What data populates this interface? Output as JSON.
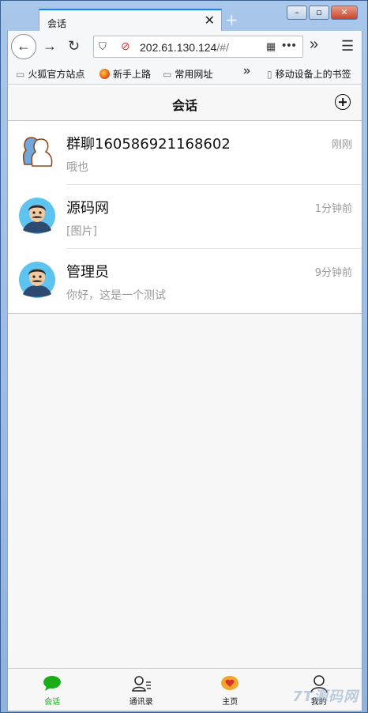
{
  "browser": {
    "tab_title": "会话",
    "tab_close": "✕",
    "new_tab": "+",
    "url_host": "202.61.130.124",
    "url_path": "/#/",
    "overflow": "»",
    "menu": "☰",
    "window_controls": [
      "–",
      "▫",
      "✕"
    ]
  },
  "bookmarks": {
    "items": [
      "火狐官方站点",
      "新手上路",
      "常用网址"
    ],
    "overflow": "»",
    "mobile": "移动设备上的书签"
  },
  "app": {
    "header_title": "会话",
    "conversations": [
      {
        "name": "群聊160586921168602",
        "time": "刚刚",
        "preview": "哦也",
        "avatar": "group-avatar-icon"
      },
      {
        "name": "源码网",
        "time": "1分钟前",
        "preview": "[图片]",
        "avatar": "user-avatar-icon"
      },
      {
        "name": "管理员",
        "time": "9分钟前",
        "preview": "你好，这是一个测试",
        "avatar": "user-avatar-icon"
      }
    ],
    "tabbar": [
      {
        "label": "会话",
        "icon": "chat-icon",
        "active": true
      },
      {
        "label": "通讯录",
        "icon": "contacts-icon",
        "active": false
      },
      {
        "label": "主页",
        "icon": "home-heart-icon",
        "active": false
      },
      {
        "label": "我的",
        "icon": "profile-icon",
        "active": false
      }
    ],
    "watermark": "7T源码网"
  },
  "colors": {
    "active_tab": "#1aad19",
    "muted_text": "#9a9a9a",
    "browser_accent": "#0a84ff"
  }
}
